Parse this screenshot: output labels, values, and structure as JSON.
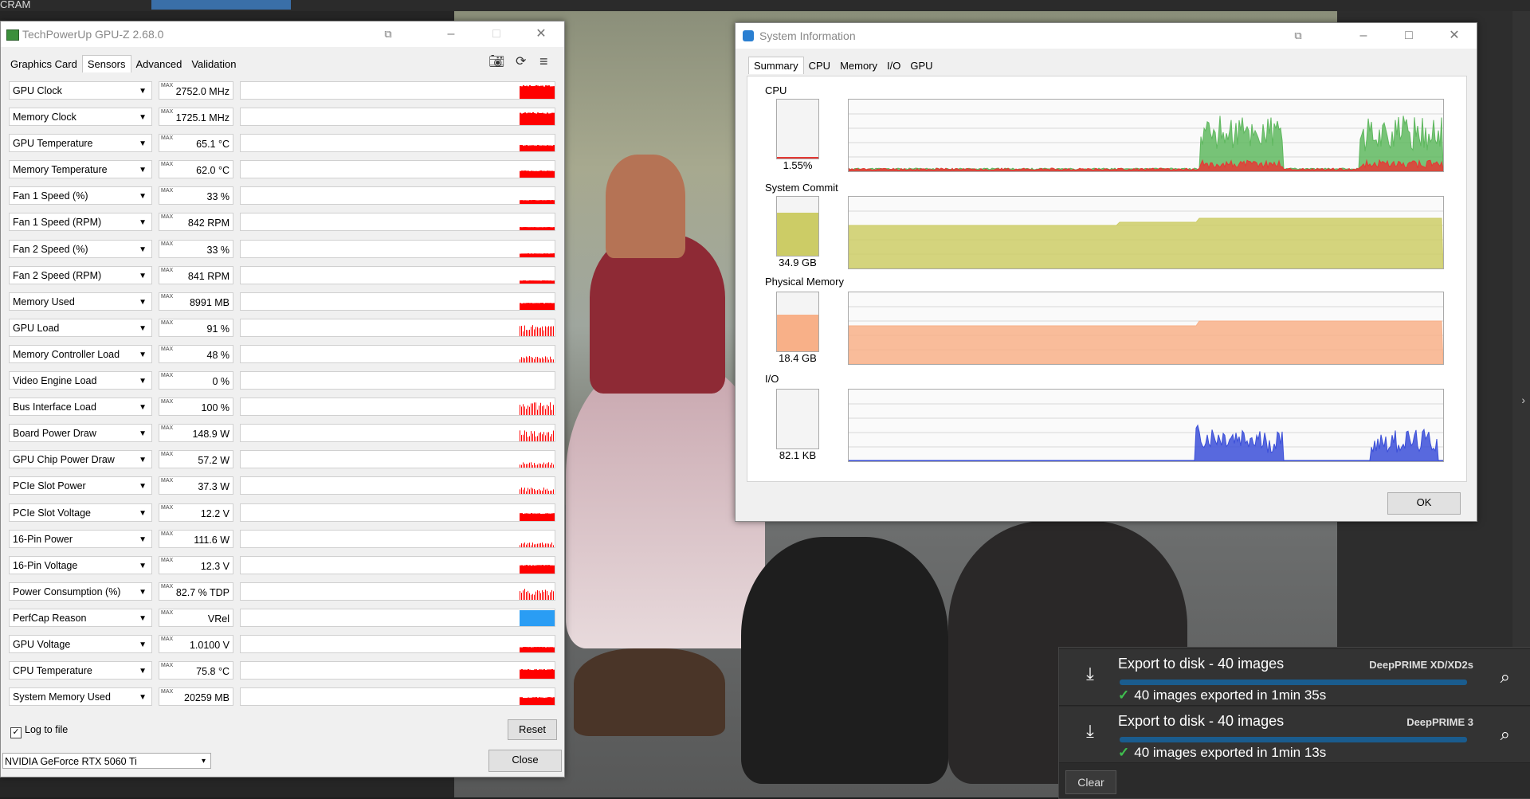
{
  "background": {
    "top_label": "CRAM"
  },
  "gpuz": {
    "title": "TechPowerUp GPU-Z 2.68.0",
    "tabs": [
      {
        "label": "Graphics Card"
      },
      {
        "label": "Sensors"
      },
      {
        "label": "Advanced"
      },
      {
        "label": "Validation"
      }
    ],
    "max_tag": "MAX",
    "sensors": [
      {
        "name": "GPU Clock",
        "value": "2752.0 MHz"
      },
      {
        "name": "Memory Clock",
        "value": "1725.1 MHz"
      },
      {
        "name": "GPU Temperature",
        "value": "65.1 °C"
      },
      {
        "name": "Memory Temperature",
        "value": "62.0 °C"
      },
      {
        "name": "Fan 1 Speed (%)",
        "value": "33 %"
      },
      {
        "name": "Fan 1 Speed (RPM)",
        "value": "842 RPM"
      },
      {
        "name": "Fan 2 Speed (%)",
        "value": "33 %"
      },
      {
        "name": "Fan 2 Speed (RPM)",
        "value": "841 RPM"
      },
      {
        "name": "Memory Used",
        "value": "8991 MB"
      },
      {
        "name": "GPU Load",
        "value": "91 %"
      },
      {
        "name": "Memory Controller Load",
        "value": "48 %"
      },
      {
        "name": "Video Engine Load",
        "value": "0 %"
      },
      {
        "name": "Bus Interface Load",
        "value": "100 %"
      },
      {
        "name": "Board Power Draw",
        "value": "148.9 W"
      },
      {
        "name": "GPU Chip Power Draw",
        "value": "57.2 W"
      },
      {
        "name": "PCIe Slot Power",
        "value": "37.3 W"
      },
      {
        "name": "PCIe Slot Voltage",
        "value": "12.2 V"
      },
      {
        "name": "16-Pin Power",
        "value": "111.6 W"
      },
      {
        "name": "16-Pin Voltage",
        "value": "12.3 V"
      },
      {
        "name": "Power Consumption (%)",
        "value": "82.7 % TDP"
      },
      {
        "name": "PerfCap Reason",
        "value": "VRel"
      },
      {
        "name": "GPU Voltage",
        "value": "1.0100 V"
      },
      {
        "name": "CPU Temperature",
        "value": "75.8 °C"
      },
      {
        "name": "System Memory Used",
        "value": "20259 MB"
      }
    ],
    "log_to_file_label": "Log to file",
    "log_to_file_checked": "✓",
    "reset_label": "Reset",
    "close_label": "Close",
    "gpu_selected": "NVIDIA GeForce RTX 5060 Ti",
    "graph_color": "#ff0000",
    "perfcap_color": "#2a9df4"
  },
  "sysinfo": {
    "title": "System Information",
    "tabs": [
      {
        "label": "Summary"
      },
      {
        "label": "CPU"
      },
      {
        "label": "Memory"
      },
      {
        "label": "I/O"
      },
      {
        "label": "GPU"
      }
    ],
    "sections": [
      {
        "label": "CPU",
        "value": "1.55%",
        "color": "#e53935"
      },
      {
        "label": "System Commit",
        "value": "34.9 GB",
        "color": "#cccc66"
      },
      {
        "label": "Physical Memory",
        "value": "18.4 GB",
        "color": "#f8b088"
      },
      {
        "label": "I/O",
        "value": "82.1  KB",
        "color": "#3b4fd8"
      }
    ],
    "ok_label": "OK"
  },
  "export": {
    "items": [
      {
        "title": "Export to disk  - 40 images",
        "tag": "DeepPRIME XD/XD2s",
        "status": "40 images exported in 1min 35s"
      },
      {
        "title": "Export to disk  - 40 images",
        "tag": "DeepPRIME 3",
        "status": "40 images exported in 1min 13s"
      }
    ],
    "check_glyph": "✓",
    "clear_label": "Clear"
  }
}
